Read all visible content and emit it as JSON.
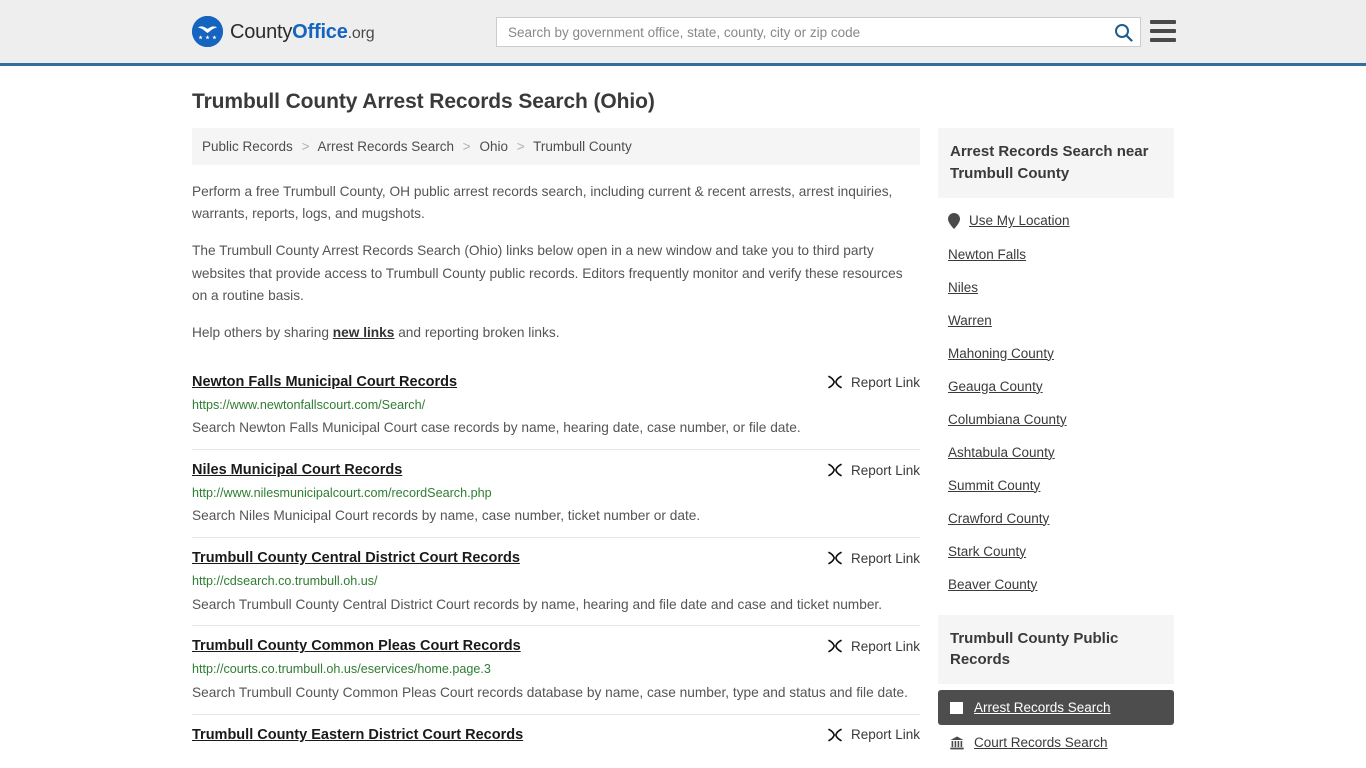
{
  "header": {
    "brand": {
      "part1": "County",
      "part2": "Office",
      "part3": ".org"
    },
    "search": {
      "placeholder": "Search by government office, state, county, city or zip code",
      "value": ""
    },
    "accent_color": "#31709b",
    "brand_blue": "#1565c0"
  },
  "page_title": "Trumbull County Arrest Records Search (Ohio)",
  "breadcrumb": [
    {
      "label": "Public Records",
      "current": false
    },
    {
      "label": "Arrest Records Search",
      "current": false
    },
    {
      "label": "Ohio",
      "current": false
    },
    {
      "label": "Trumbull County",
      "current": true
    }
  ],
  "breadcrumb_separator": ">",
  "intro": {
    "p1": "Perform a free Trumbull County, OH public arrest records search, including current & recent arrests, arrest inquiries, warrants, reports, logs, and mugshots.",
    "p2": "The Trumbull County Arrest Records Search (Ohio) links below open in a new window and take you to third party websites that provide access to Trumbull County public records. Editors frequently monitor and verify these resources on a routine basis.",
    "p3_before": "Help others by sharing ",
    "p3_link": "new links",
    "p3_after": " and reporting broken links."
  },
  "report_link_label": "Report Link",
  "listings": [
    {
      "title": "Newton Falls Municipal Court Records",
      "url": "https://www.newtonfallscourt.com/Search/",
      "description": "Search Newton Falls Municipal Court case records by name, hearing date, case number, or file date."
    },
    {
      "title": "Niles Municipal Court Records",
      "url": "http://www.nilesmunicipalcourt.com/recordSearch.php",
      "description": "Search Niles Municipal Court records by name, case number, ticket number or date."
    },
    {
      "title": "Trumbull County Central District Court Records",
      "url": "http://cdsearch.co.trumbull.oh.us/",
      "description": "Search Trumbull County Central District Court records by name, hearing and file date and case and ticket number."
    },
    {
      "title": "Trumbull County Common Pleas Court Records",
      "url": "http://courts.co.trumbull.oh.us/eservices/home.page.3",
      "description": "Search Trumbull County Common Pleas Court records database by name, case number, type and status and file date."
    },
    {
      "title": "Trumbull County Eastern District Court Records",
      "url": "",
      "description": ""
    }
  ],
  "sidebar": {
    "near_panel": {
      "title": "Arrest Records Search near Trumbull County",
      "items": [
        {
          "label": "Use My Location",
          "icon": "map-pin-icon"
        },
        {
          "label": "Newton Falls",
          "icon": ""
        },
        {
          "label": "Niles",
          "icon": ""
        },
        {
          "label": "Warren",
          "icon": ""
        },
        {
          "label": "Mahoning County",
          "icon": ""
        },
        {
          "label": "Geauga County",
          "icon": ""
        },
        {
          "label": "Columbiana County",
          "icon": ""
        },
        {
          "label": "Ashtabula County",
          "icon": ""
        },
        {
          "label": "Summit County",
          "icon": ""
        },
        {
          "label": "Crawford County",
          "icon": ""
        },
        {
          "label": "Stark County",
          "icon": ""
        },
        {
          "label": "Beaver County",
          "icon": ""
        }
      ]
    },
    "public_records_panel": {
      "title": "Trumbull County Public Records",
      "items": [
        {
          "label": "Arrest Records Search",
          "icon": "document-icon",
          "active": true
        },
        {
          "label": "Court Records Search",
          "icon": "courthouse-icon",
          "active": false
        }
      ]
    }
  }
}
